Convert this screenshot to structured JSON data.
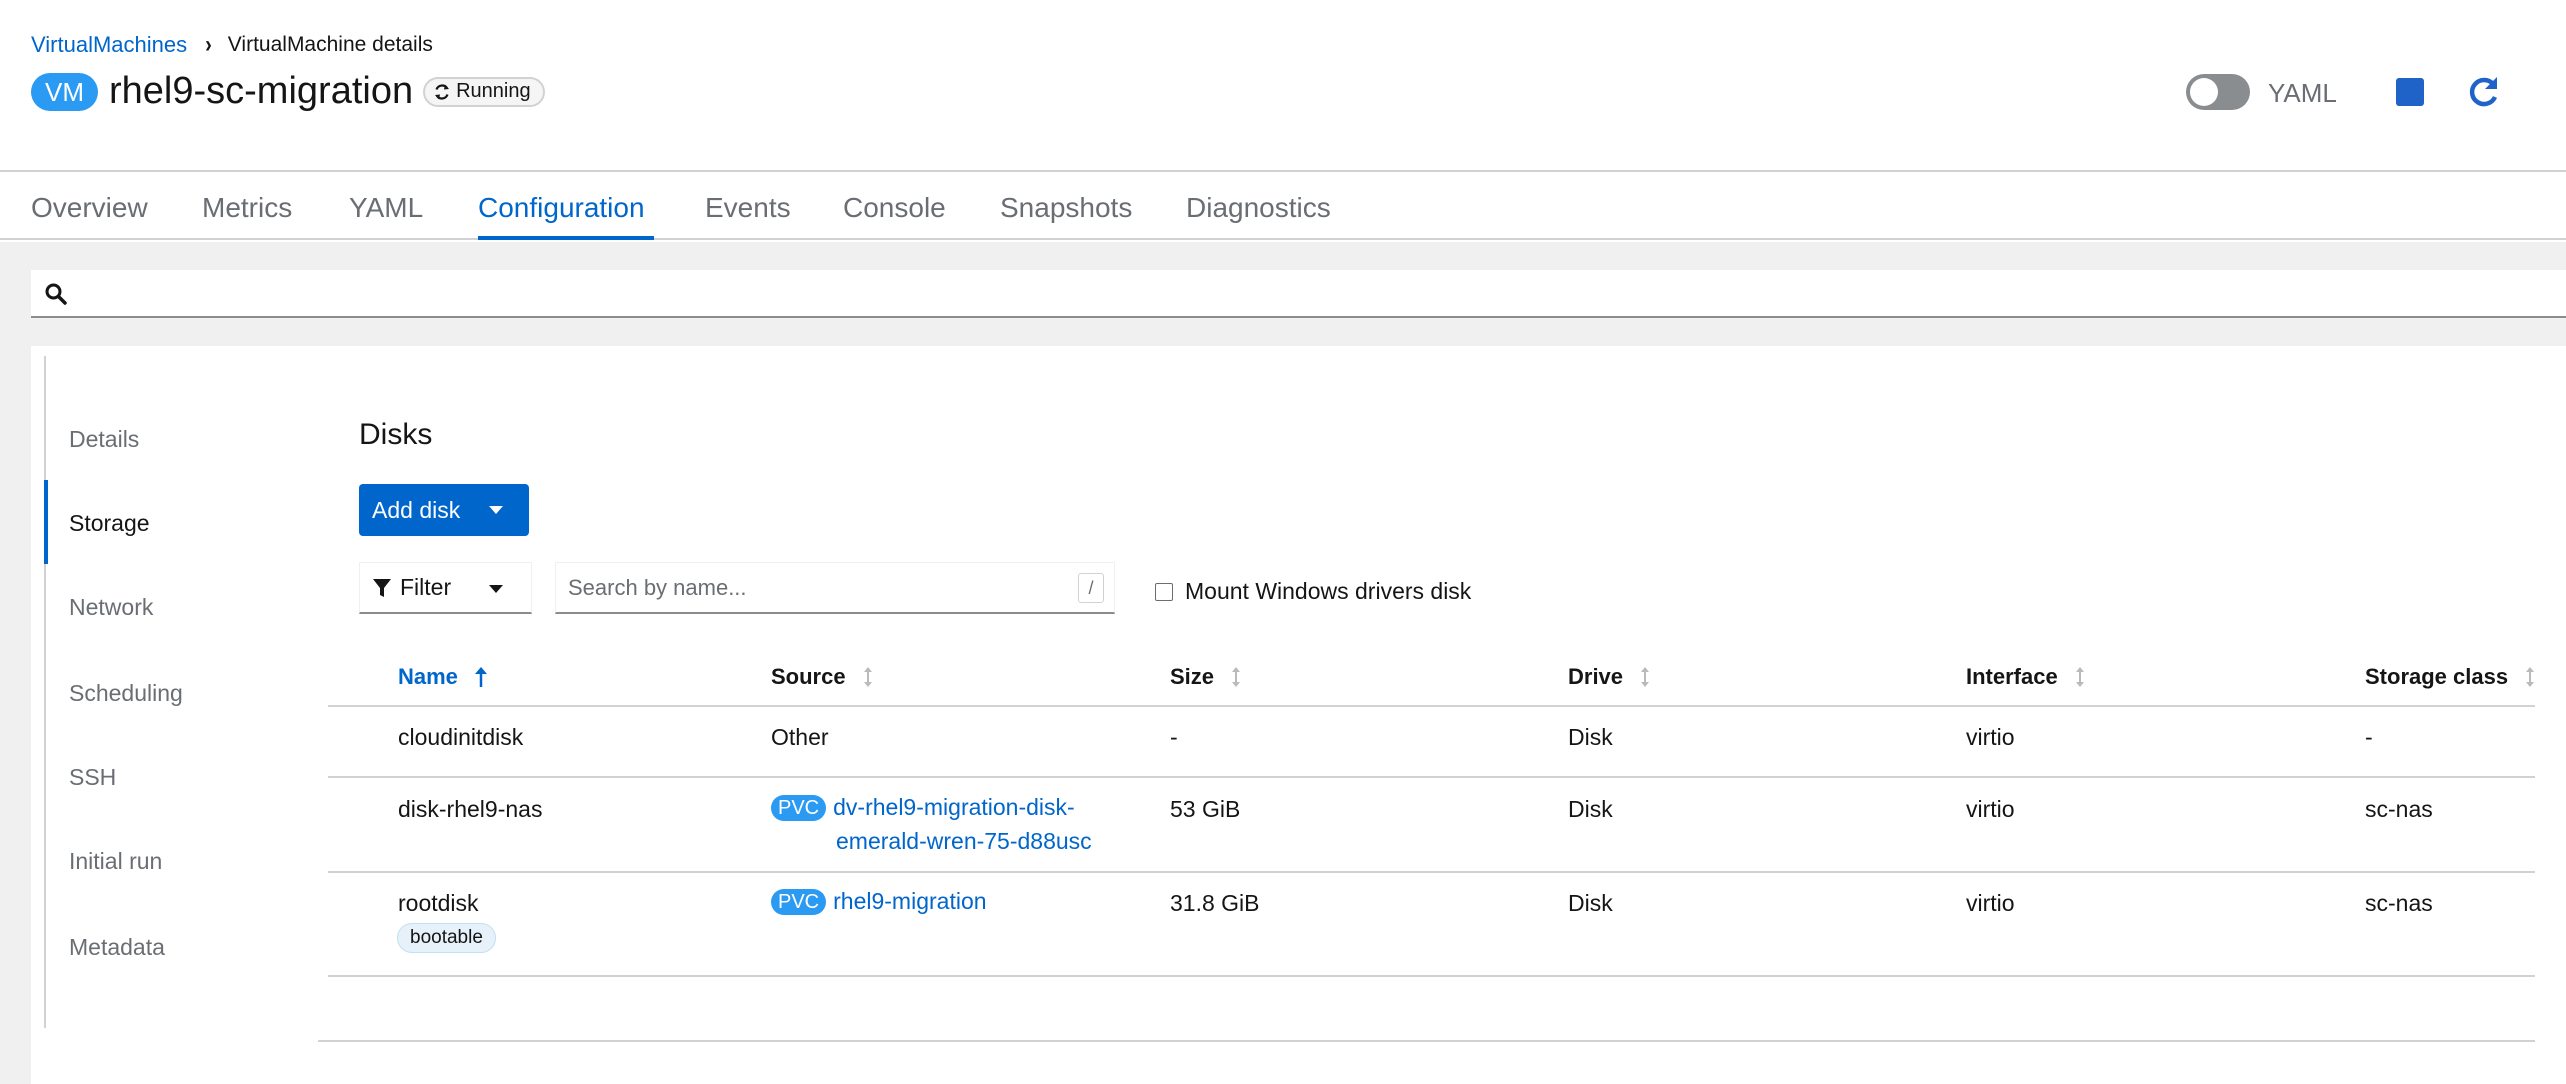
{
  "breadcrumb": {
    "parent": "VirtualMachines",
    "current": "VirtualMachine details"
  },
  "vm": {
    "badge": "VM",
    "name": "rhel9-sc-migration",
    "status": "Running"
  },
  "header_actions": {
    "yaml_label": "YAML"
  },
  "tabs": [
    {
      "label": "Overview"
    },
    {
      "label": "Metrics"
    },
    {
      "label": "YAML"
    },
    {
      "label": "Configuration",
      "active": true
    },
    {
      "label": "Events"
    },
    {
      "label": "Console"
    },
    {
      "label": "Snapshots"
    },
    {
      "label": "Diagnostics"
    }
  ],
  "side_nav": [
    {
      "label": "Details"
    },
    {
      "label": "Storage",
      "active": true
    },
    {
      "label": "Network"
    },
    {
      "label": "Scheduling"
    },
    {
      "label": "SSH"
    },
    {
      "label": "Initial run"
    },
    {
      "label": "Metadata"
    }
  ],
  "disks": {
    "title": "Disks",
    "add_label": "Add disk",
    "filter_label": "Filter",
    "search_placeholder": "Search by name...",
    "search_shortcut": "/",
    "mount_windows_label": "Mount Windows drivers disk",
    "columns": [
      "Name",
      "Source",
      "Size",
      "Drive",
      "Interface",
      "Storage class"
    ],
    "rows": [
      {
        "name": "cloudinitdisk",
        "source": "Other",
        "source_badge": "",
        "size": "-",
        "drive": "Disk",
        "interface": "virtio",
        "storage_class": "-"
      },
      {
        "name": "disk-rhel9-nas",
        "source_badge": "PVC",
        "source_line1": "dv-rhel9-migration-disk-",
        "source_line2": "emerald-wren-75-d88usc",
        "size": "53 GiB",
        "drive": "Disk",
        "interface": "virtio",
        "storage_class": "sc-nas"
      },
      {
        "name": "rootdisk",
        "label": "bootable",
        "source_badge": "PVC",
        "source": "rhel9-migration",
        "size": "31.8 GiB",
        "drive": "Disk",
        "interface": "virtio",
        "storage_class": "sc-nas"
      }
    ]
  },
  "colors": {
    "accent": "#0066cc",
    "badge_blue": "#2b9af3",
    "stop_blue": "#1f62c8"
  }
}
